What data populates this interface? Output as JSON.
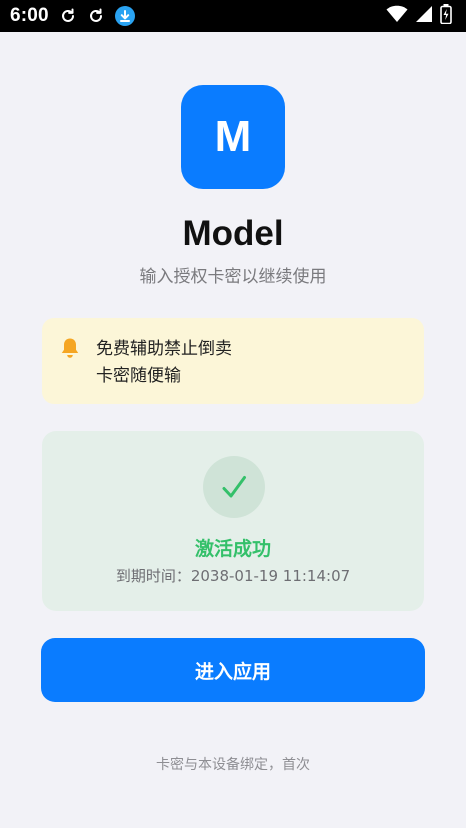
{
  "status_bar": {
    "time": "6:00",
    "icons": [
      "sync-icon",
      "sync-icon",
      "download-icon",
      "wifi-icon",
      "signal-icon",
      "battery-charging-icon"
    ]
  },
  "app": {
    "logo_letter": "M",
    "title": "Model",
    "subtitle": "输入授权卡密以继续使用"
  },
  "notice": {
    "icon": "bell-icon",
    "line1": "免费辅助禁止倒卖",
    "line2": "卡密随便输"
  },
  "activation": {
    "status": "激活成功",
    "expire_label": "到期时间：",
    "expire_value": "2038-01-19 11:14:07"
  },
  "actions": {
    "enter_label": "进入应用"
  },
  "footer": {
    "note": "卡密与本设备绑定，首次"
  },
  "colors": {
    "primary": "#0a7cff",
    "success": "#34c06a",
    "notice_bg": "#fcf6d8",
    "success_bg": "#e4efe9",
    "page_bg": "#f2f2f7",
    "bell": "#f5a623"
  }
}
